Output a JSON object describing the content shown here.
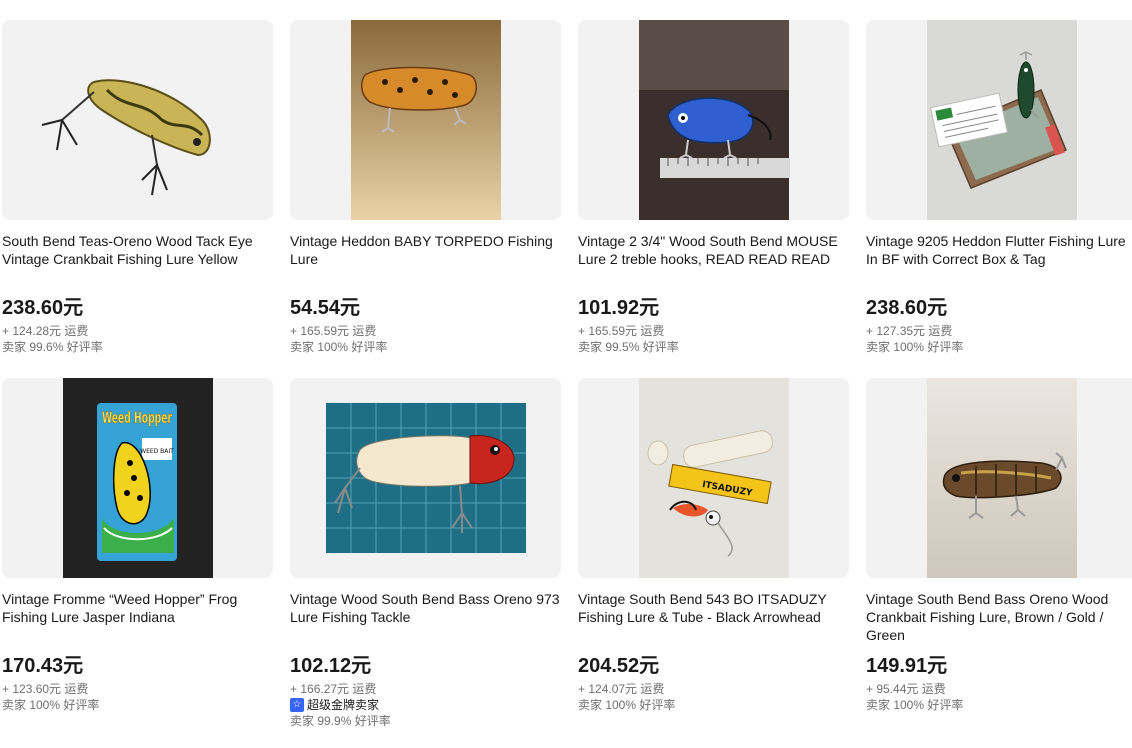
{
  "listings": [
    {
      "title": "South Bend Teas-Oreno Wood Tack Eye Vintage Crankbait Fishing Lure Yellow",
      "price": "238.60元",
      "shipping": "+ 124.28元 运费",
      "seller": "卖家 99.6% 好评率",
      "image": "yellow-crankbait-lure"
    },
    {
      "title": "Vintage Heddon BABY TORPEDO Fishing Lure",
      "price": "54.54元",
      "shipping": "+ 165.59元 运费",
      "seller": "卖家 100% 好评率",
      "image": "orange-torpedo-lure"
    },
    {
      "title": "Vintage 2 3/4\" Wood South Bend MOUSE Lure 2 treble hooks, READ READ READ",
      "price": "101.92元",
      "shipping": "+ 165.59元 运费",
      "seller": "卖家 99.5% 好评率",
      "image": "blue-mouse-lure"
    },
    {
      "title": "Vintage 9205 Heddon Flutter Fishing Lure In BF with Correct Box & Tag",
      "price": "238.60元",
      "shipping": "+ 127.35元 运费",
      "seller": "卖家 100% 好评率",
      "image": "flutter-lure-in-box"
    },
    {
      "title": "Vintage Fromme “Weed Hopper” Frog Fishing Lure Jasper Indiana",
      "price": "170.43元",
      "shipping": "+ 123.60元 运费",
      "seller": "卖家 100% 好评率",
      "image": "weed-hopper-card",
      "card_text": {
        "brand": "Weed Hopper",
        "sub": "WEED BAIT"
      }
    },
    {
      "title": "Vintage Wood South Bend Bass Oreno 973 Lure Fishing Tackle",
      "price": "102.12元",
      "shipping": "+ 166.27元 运费",
      "badge": "超级金牌卖家",
      "seller": "卖家 99.9% 好评率",
      "image": "red-white-bass-oreno"
    },
    {
      "title": "Vintage South Bend 543 BO ITSADUZY Fishing Lure & Tube - Black Arrowhead",
      "price": "204.52元",
      "shipping": "+ 124.07元 运费",
      "seller": "卖家 100% 好评率",
      "image": "itsaduzy-lure-tube",
      "card_text": {
        "label": "ITSADUZY"
      }
    },
    {
      "title": "Vintage South Bend Bass Oreno Wood Crankbait Fishing Lure, Brown / Gold / Green",
      "price": "149.91元",
      "shipping": "+ 95.44元 运费",
      "seller": "卖家 100% 好评率",
      "image": "brown-bass-oreno"
    }
  ],
  "colors": {
    "text": "#191919",
    "muted": "#707070",
    "tile_bg": "#f2f2f2",
    "badge_blue": "#3665f3"
  }
}
